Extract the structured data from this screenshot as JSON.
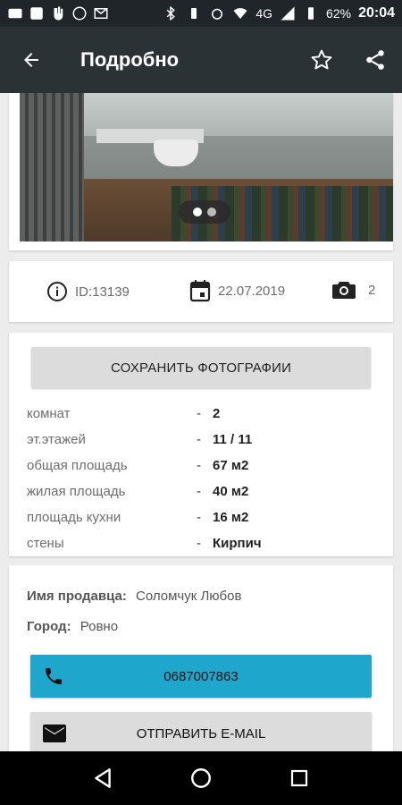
{
  "status_bar": {
    "left_icons": [
      "mail-icon",
      "photo-icon",
      "hand-icon",
      "viber-icon",
      "gmail-icon"
    ],
    "network": "4G",
    "battery": "62%",
    "time": "20:04"
  },
  "app_bar": {
    "title": "Подробно",
    "back_icon": "arrow-back-icon",
    "actions": [
      "star-outline-icon",
      "share-icon"
    ]
  },
  "photo": {
    "dots_count": 2,
    "active_dot": 0
  },
  "info": {
    "id_label": "ID:13139",
    "date": "22.07.2019",
    "photo_count": "2"
  },
  "details": {
    "save_photos_label": "СОХРАНИТЬ ФОТОГРАФИИ",
    "properties": [
      {
        "label": "комнат",
        "dash": "-",
        "value": "2"
      },
      {
        "label": "эт.этажей",
        "dash": "-",
        "value": "11 / 11"
      },
      {
        "label": "общая площадь",
        "dash": "-",
        "value": "67 м2"
      },
      {
        "label": "жилая площадь",
        "dash": "-",
        "value": "40 м2"
      },
      {
        "label": "площадь кухни",
        "dash": "-",
        "value": "16 м2"
      },
      {
        "label": "стены",
        "dash": "-",
        "value": "Кирпич"
      }
    ]
  },
  "seller": {
    "name_label": "Имя продавца:",
    "name_value": "Соломчук Любов",
    "city_label": "Город:",
    "city_value": "Ровно",
    "phone": "0687007863",
    "email_button": "ОТПРАВИТЬ E-MAIL"
  },
  "colors": {
    "app_bar": "#2b3236",
    "status_bar": "#1f2529",
    "call_button": "#1fa6cc",
    "button_gray": "#dcdcdc",
    "background": "#ececec"
  }
}
